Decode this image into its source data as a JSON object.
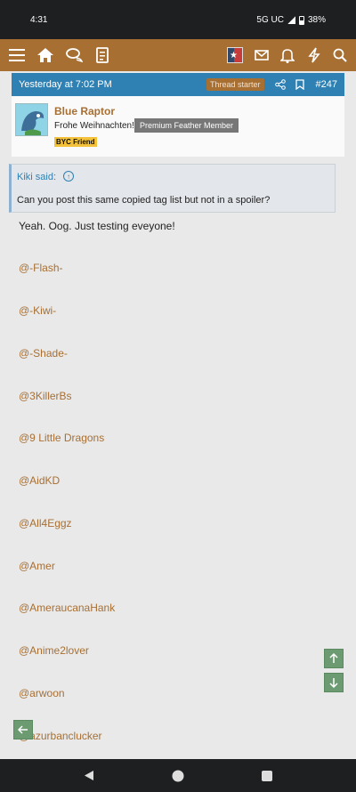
{
  "status_bar": {
    "time": "4:31",
    "network": "5G UC",
    "battery": "38%"
  },
  "nav": {
    "icons": [
      "menu-icon",
      "home-icon",
      "forums-icon",
      "document-icon",
      "avatar",
      "mail-icon",
      "bell-icon",
      "bolt-icon",
      "search-icon"
    ],
    "color": "#a86f33"
  },
  "post": {
    "timestamp": "Yesterday at 7:02 PM",
    "starter_badge": "Thread starter",
    "post_number": "#247",
    "username": "Blue Raptor",
    "user_title": "Frohe Weihnachten!",
    "member_badge": "Premium Feather Member",
    "friend_badge": "BYC Friend",
    "quote": {
      "author": "Kiki said:",
      "text": "Can you post this same copied tag list but not in a spoiler?"
    },
    "body": "Yeah. Oog. Just testing eveyone!",
    "mentions": [
      "@-Flash-",
      "@-Kiwi-",
      "@-Shade-",
      "@3KillerBs",
      "@9 Little Dragons",
      "@AidKD",
      "@All4Eggz",
      "@Amer",
      "@AmeraucanaHank",
      "@Anime2lover",
      "@arwoon",
      "@azurbanclucker"
    ]
  },
  "colors": {
    "header_blue": "#2f81b3",
    "brown": "#a86f33",
    "green": "#6c9b71"
  }
}
